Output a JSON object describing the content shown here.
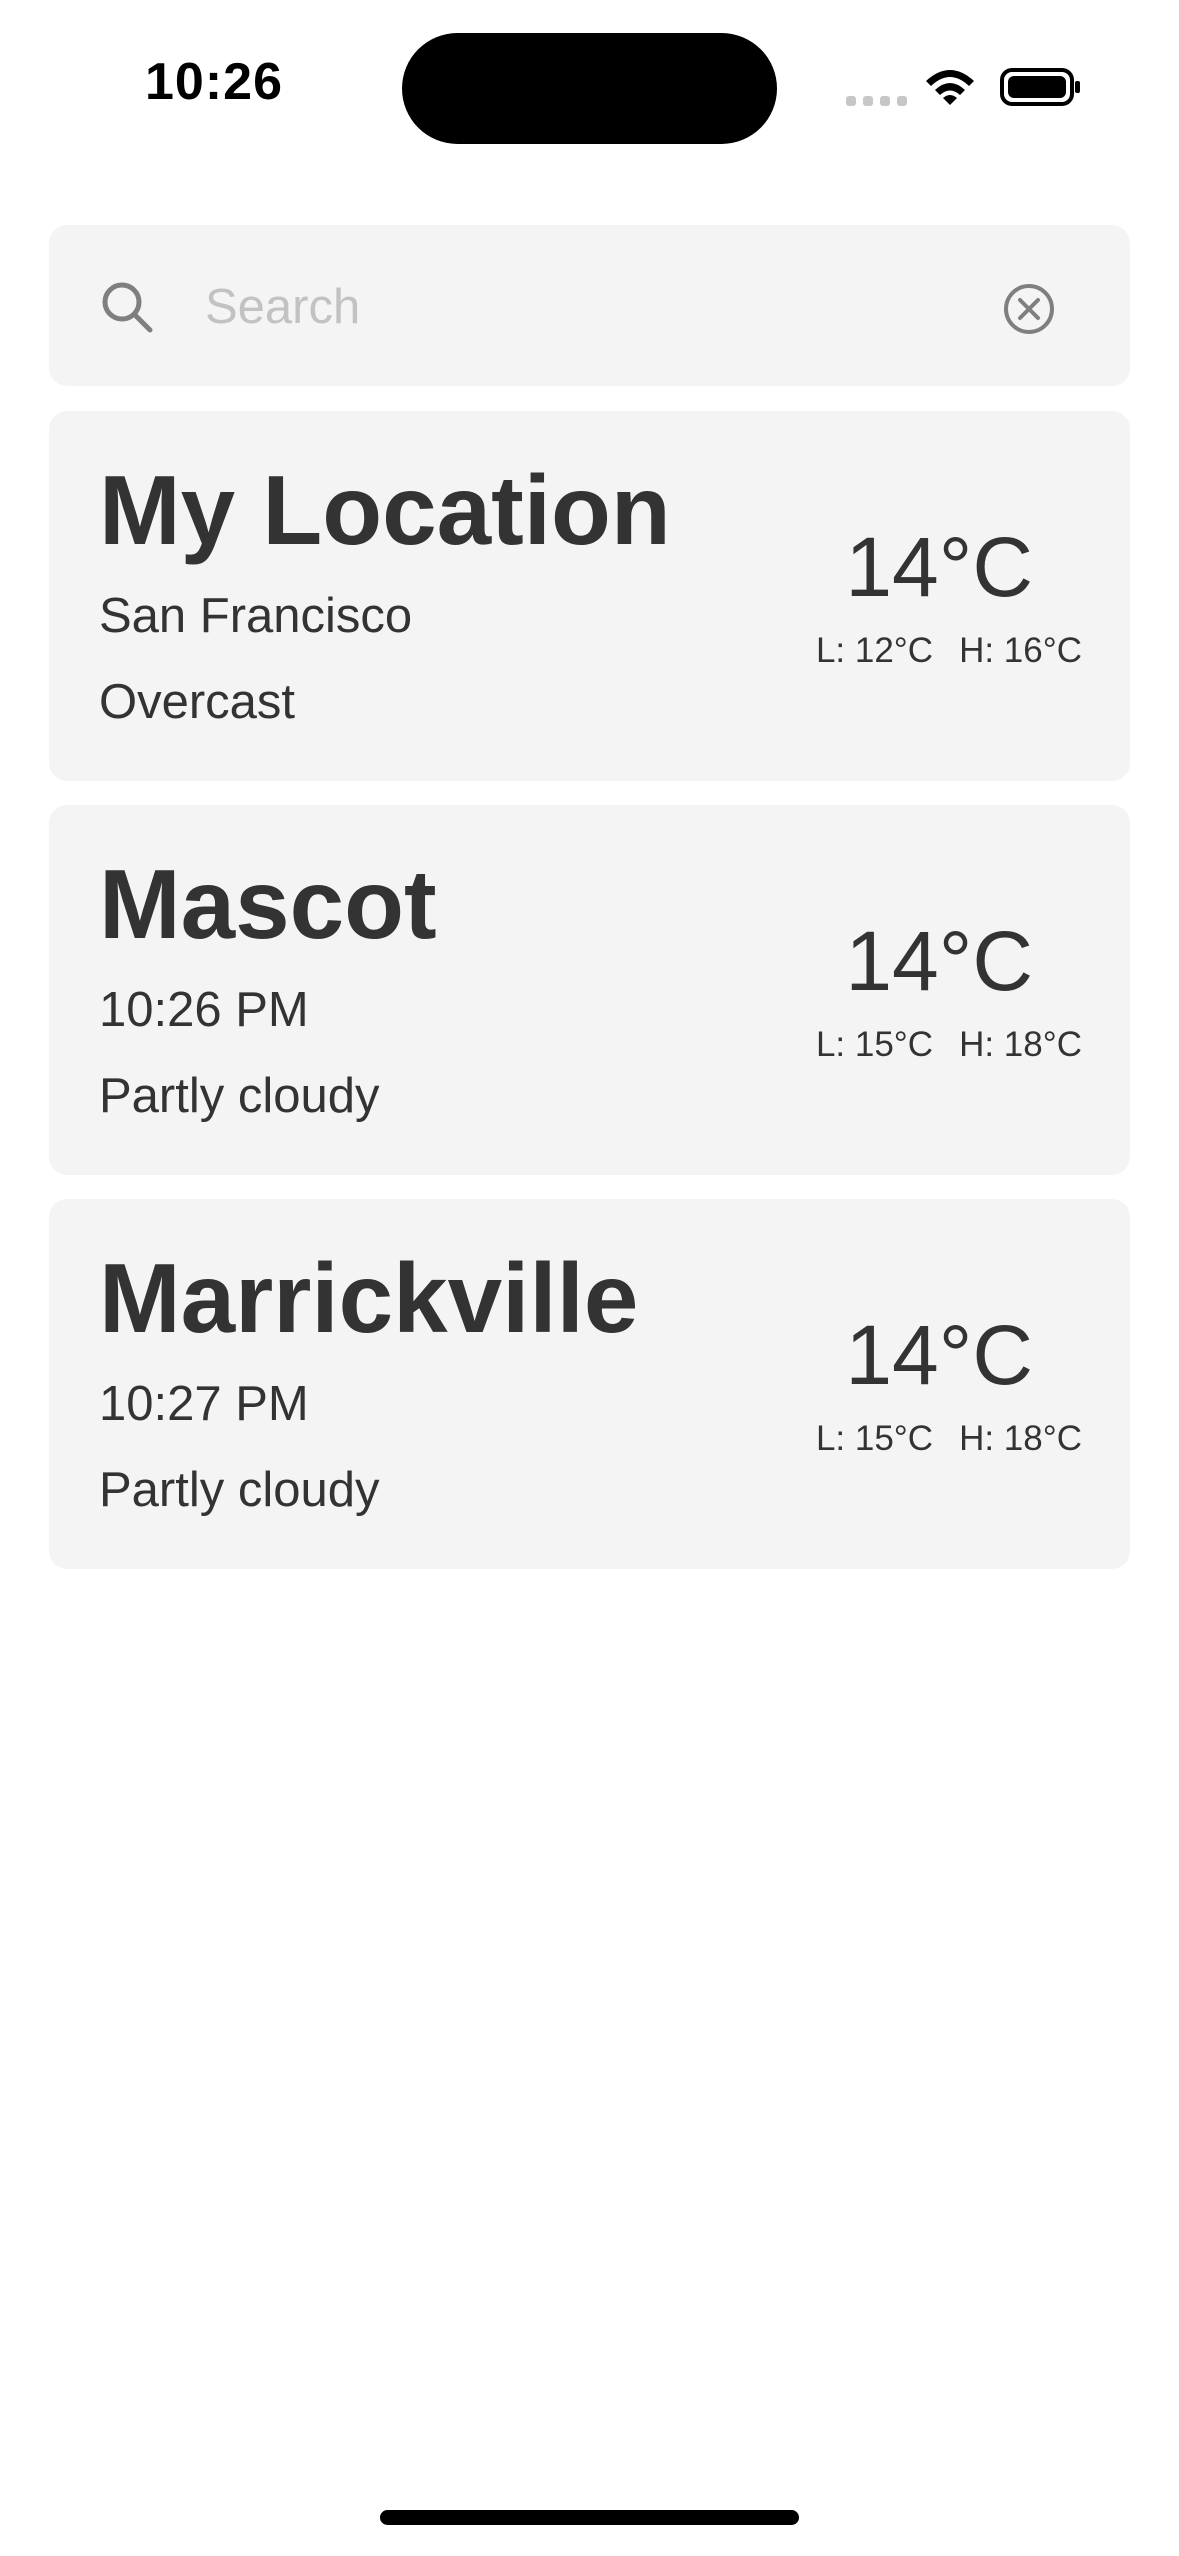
{
  "status_bar": {
    "time": "10:26"
  },
  "search": {
    "placeholder": "Search",
    "value": ""
  },
  "locations": [
    {
      "title": "My Location",
      "subtitle": "San Francisco",
      "condition": "Overcast",
      "temperature": "14°C",
      "low": "L: 12°C",
      "high": "H: 16°C"
    },
    {
      "title": "Mascot",
      "subtitle": "10:26 PM",
      "condition": "Partly cloudy",
      "temperature": "14°C",
      "low": "L: 15°C",
      "high": "H: 18°C"
    },
    {
      "title": "Marrickville",
      "subtitle": "10:27 PM",
      "condition": "Partly cloudy",
      "temperature": "14°C",
      "low": "L: 15°C",
      "high": "H: 18°C"
    }
  ],
  "icons": {
    "search": "search-icon",
    "clear": "clear-icon",
    "wifi": "wifi-icon",
    "battery": "battery-icon",
    "cellular": "cellular-signal-icon"
  },
  "colors": {
    "card_background": "#f4f4f4",
    "text_primary": "#333333",
    "placeholder": "#c2c2c2",
    "status_icon": "#000000"
  }
}
